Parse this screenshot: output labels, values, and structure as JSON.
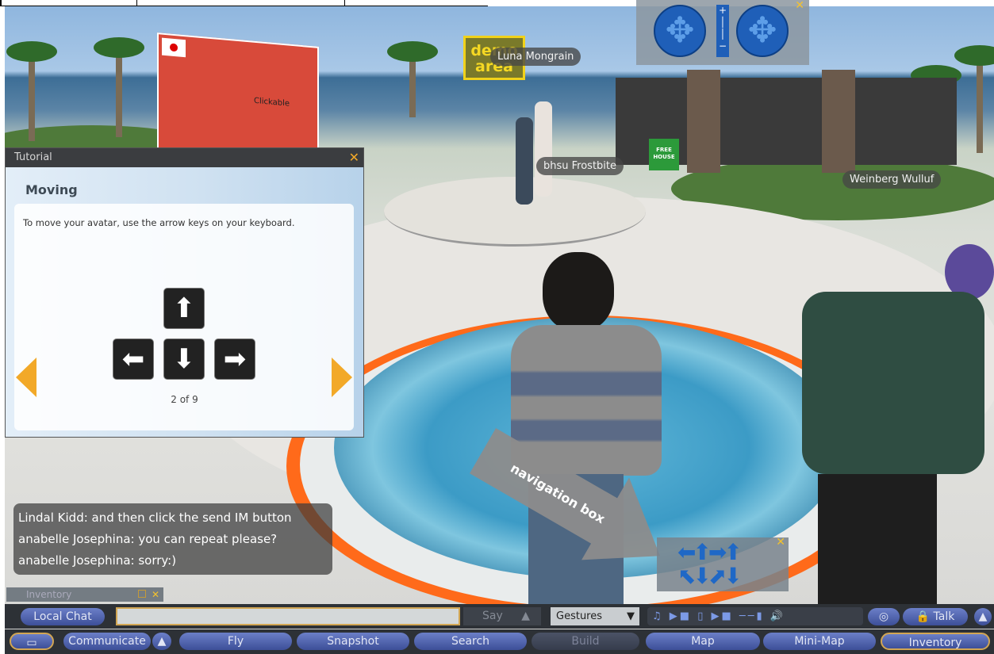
{
  "scene": {
    "sign_demo": "demo area",
    "sign_free_house": "FREE HOUSE",
    "billboard_text": "Clickable"
  },
  "avatars": {
    "luna": "Luna Mongrain",
    "bhsu": "bhsu Frostbite",
    "weinberg": "Weinberg Wulluf"
  },
  "tutorial": {
    "title": "Tutorial",
    "heading": "Moving",
    "message": "To move your avatar, use the arrow keys on your keyboard.",
    "pager": "2 of 9",
    "keys": {
      "up": "⬆",
      "left": "⬅",
      "down": "⬇",
      "right": "➡"
    }
  },
  "chat": {
    "lines": [
      "Lindal Kidd: and then click the send IM button",
      "anabelle Josephina: you can repeat please?",
      "anabelle Josephina: sorry:)"
    ]
  },
  "annotation": {
    "label": "navigation box"
  },
  "inventory_mini": {
    "title": "Inventory"
  },
  "chatbar": {
    "local_chat": "Local Chat",
    "input_value": "",
    "say": "Say",
    "gestures": "Gestures",
    "talk": "Talk",
    "media_controls": "♫ ▶■ ▯ ▶■ ──▮ 🔊"
  },
  "toolbar": {
    "communicate": "Communicate",
    "fly": "Fly",
    "snapshot": "Snapshot",
    "search": "Search",
    "build": "Build",
    "map": "Map",
    "minimap": "Mini-Map",
    "inventory": "Inventory"
  },
  "colors": {
    "accent_orange": "#f2a928",
    "button_blue": "#3d4f98",
    "toolbar_bg": "#2d3136"
  }
}
